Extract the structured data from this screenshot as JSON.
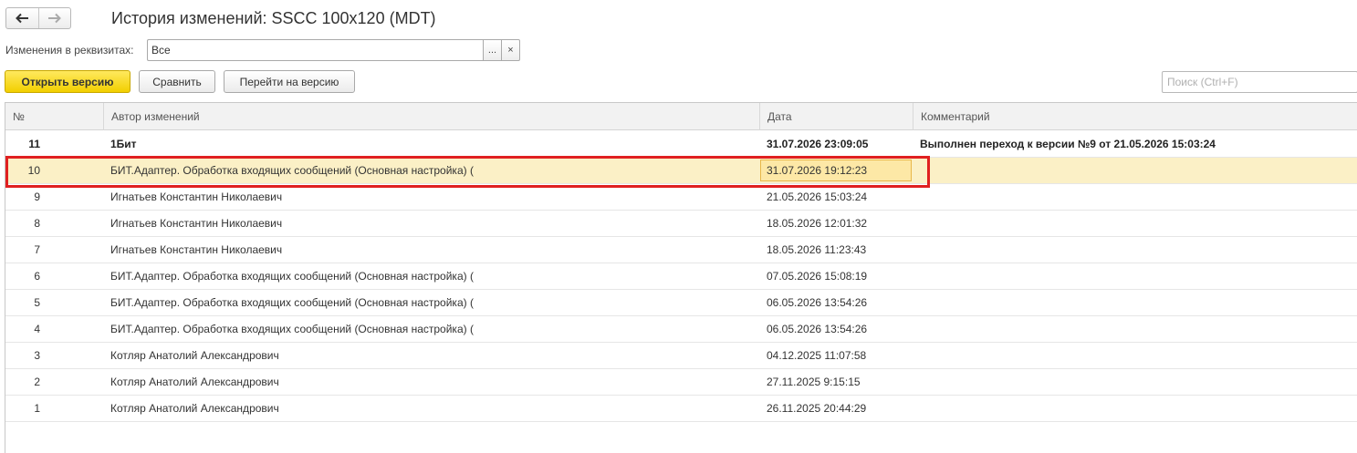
{
  "window": {
    "title": "История изменений: SSCC 100x120 (MDT)"
  },
  "nav": {
    "back_icon": "arrow-left-icon",
    "forward_icon": "arrow-right-icon"
  },
  "filter": {
    "label": "Изменения в реквизитах:",
    "value": "Все",
    "more_label": "...",
    "clear_label": "×"
  },
  "toolbar": {
    "open_version": "Открыть версию",
    "compare": "Сравнить",
    "go_to_version": "Перейти на версию",
    "search_placeholder": "Поиск (Ctrl+F)"
  },
  "table": {
    "columns": [
      "№",
      "Автор изменений",
      "Дата",
      "Комментарий"
    ],
    "rows": [
      {
        "num": "11",
        "author": "1Бит",
        "date": "31.07.2026 23:09:05",
        "comment": "Выполнен переход к версии №9 от 21.05.2026 15:03:24"
      },
      {
        "num": "10",
        "author": "БИТ.Адаптер. Обработка входящих сообщений (Основная настройка) (",
        "date": "31.07.2026 19:12:23",
        "comment": ""
      },
      {
        "num": "9",
        "author": "Игнатьев Константин Николаевич",
        "date": "21.05.2026 15:03:24",
        "comment": ""
      },
      {
        "num": "8",
        "author": "Игнатьев Константин Николаевич",
        "date": "18.05.2026 12:01:32",
        "comment": ""
      },
      {
        "num": "7",
        "author": "Игнатьев Константин Николаевич",
        "date": "18.05.2026 11:23:43",
        "comment": ""
      },
      {
        "num": "6",
        "author": "БИТ.Адаптер. Обработка входящих сообщений (Основная настройка) (",
        "date": "07.05.2026 15:08:19",
        "comment": ""
      },
      {
        "num": "5",
        "author": "БИТ.Адаптер. Обработка входящих сообщений (Основная настройка) (",
        "date": "06.05.2026 13:54:26",
        "comment": ""
      },
      {
        "num": "4",
        "author": "БИТ.Адаптер. Обработка входящих сообщений (Основная настройка) (",
        "date": "06.05.2026 13:54:26",
        "comment": ""
      },
      {
        "num": "3",
        "author": "Котляр Анатолий Александрович",
        "date": "04.12.2025 11:07:58",
        "comment": ""
      },
      {
        "num": "2",
        "author": "Котляр Анатолий Александрович",
        "date": "27.11.2025 9:15:15",
        "comment": ""
      },
      {
        "num": "1",
        "author": "Котляр Анатолий Александрович",
        "date": "26.11.2025 20:44:29",
        "comment": ""
      }
    ]
  },
  "colors": {
    "primary_button": "#f2cf00",
    "selected_row": "#fbf0c6",
    "highlight_frame": "#e02020"
  }
}
